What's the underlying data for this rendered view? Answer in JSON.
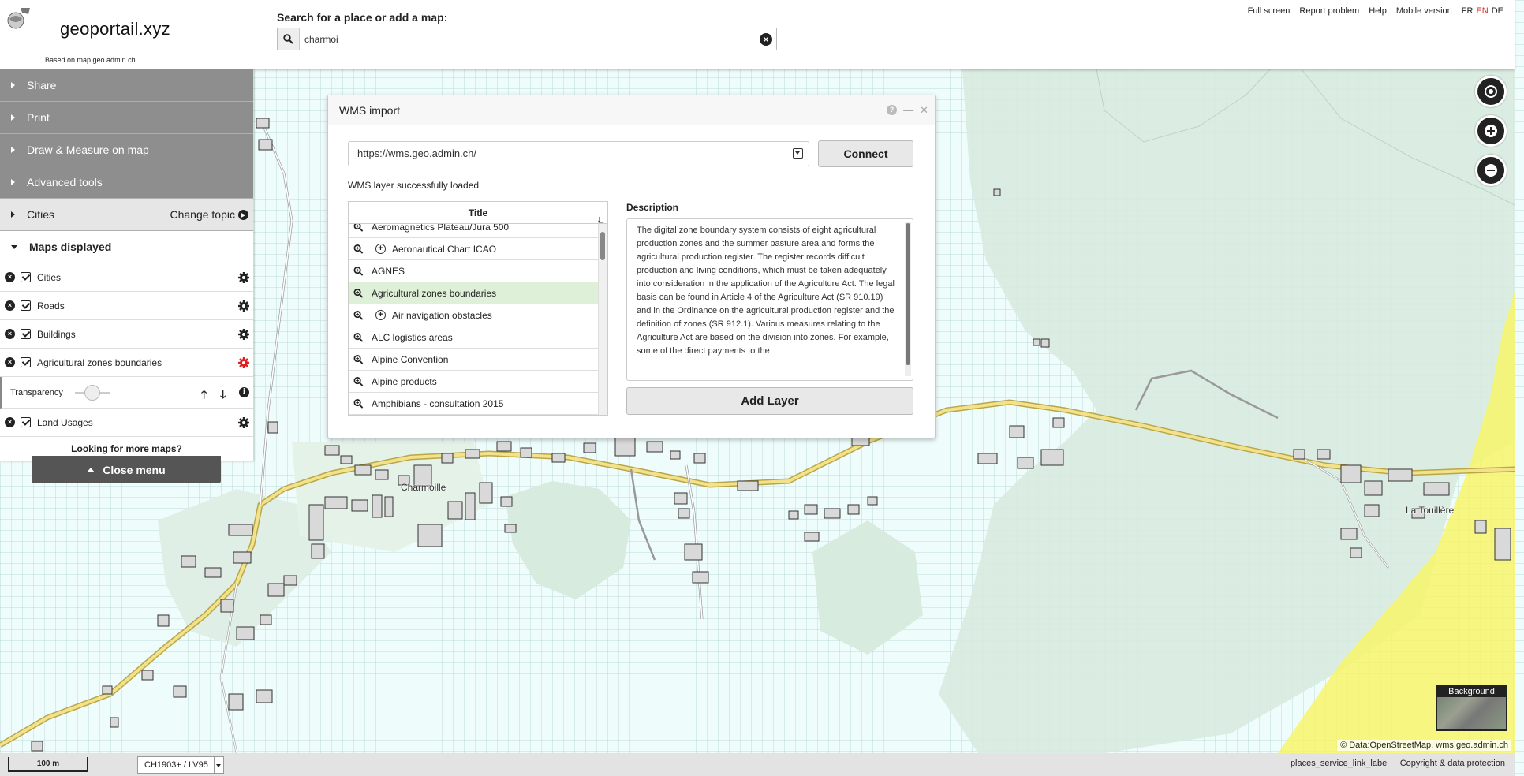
{
  "header": {
    "title": "geoportail.xyz",
    "based_on": "Based on map.geo.admin.ch",
    "search_label": "Search for a place or add a map:",
    "search_value": "charmoi",
    "links": [
      "Full screen",
      "Report problem",
      "Help",
      "Mobile version"
    ],
    "languages": [
      "FR",
      "EN",
      "DE"
    ],
    "active_language": "EN"
  },
  "sidebar": {
    "sections": [
      "Share",
      "Print",
      "Draw & Measure on map",
      "Advanced tools"
    ],
    "topic": "Cities",
    "change_topic": "Change topic",
    "maps_displayed": "Maps displayed",
    "layers": [
      "Cities",
      "Roads",
      "Buildings",
      "Agricultural zones boundaries",
      "Land Usages"
    ],
    "transparency_label": "Transparency",
    "more_maps": "Looking for more maps?",
    "close_menu": "Close menu"
  },
  "wms": {
    "title": "WMS import",
    "url": "https://wms.geo.admin.ch/",
    "connect": "Connect",
    "status": "WMS layer successfully loaded",
    "table_header": "Title",
    "rows": [
      {
        "label": "Aeromagnetics Plateau/Jura 500",
        "expandable": false,
        "selected": false
      },
      {
        "label": "Aeronautical Chart ICAO",
        "expandable": true,
        "selected": false
      },
      {
        "label": "AGNES",
        "expandable": false,
        "selected": false
      },
      {
        "label": "Agricultural zones boundaries",
        "expandable": false,
        "selected": true
      },
      {
        "label": "Air navigation obstacles",
        "expandable": true,
        "selected": false
      },
      {
        "label": "ALC logistics areas",
        "expandable": false,
        "selected": false
      },
      {
        "label": "Alpine Convention",
        "expandable": false,
        "selected": false
      },
      {
        "label": "Alpine products",
        "expandable": false,
        "selected": false
      },
      {
        "label": "Amphibians - consultation 2015",
        "expandable": false,
        "selected": false
      }
    ],
    "description_label": "Description",
    "description": "The digital zone boundary system consists of eight agricultural production zones and the summer pasture area and forms the agricultural production register. The register records difficult production and living conditions, which must be taken adequately into consideration in the application of the Agriculture Act. The legal basis can be found in Article 4 of the Agriculture Act (SR 910.19) and in the Ordinance on the agricultural production register and the definition of zones (SR 912.1). Various measures relating to the Agriculture Act are based on the division into zones. For example, some of the direct payments to the",
    "add_layer": "Add Layer"
  },
  "map": {
    "places": [
      "Charmoille",
      "La Touillère"
    ],
    "scale": "100 m",
    "projection": "CH1903+ / LV95",
    "attribution": "© Data:OpenStreetMap, wms.geo.admin.ch",
    "background_label": "Background",
    "bottom_links": [
      "places_service_link_label",
      "Copyright & data protection"
    ]
  },
  "colors": {
    "road": "#e8d36a",
    "sidebar_section": "#8e8e8e",
    "selected_row": "#dff0d8",
    "zone_yellow": "#f7f56a",
    "forest": "#d8ebdf"
  }
}
